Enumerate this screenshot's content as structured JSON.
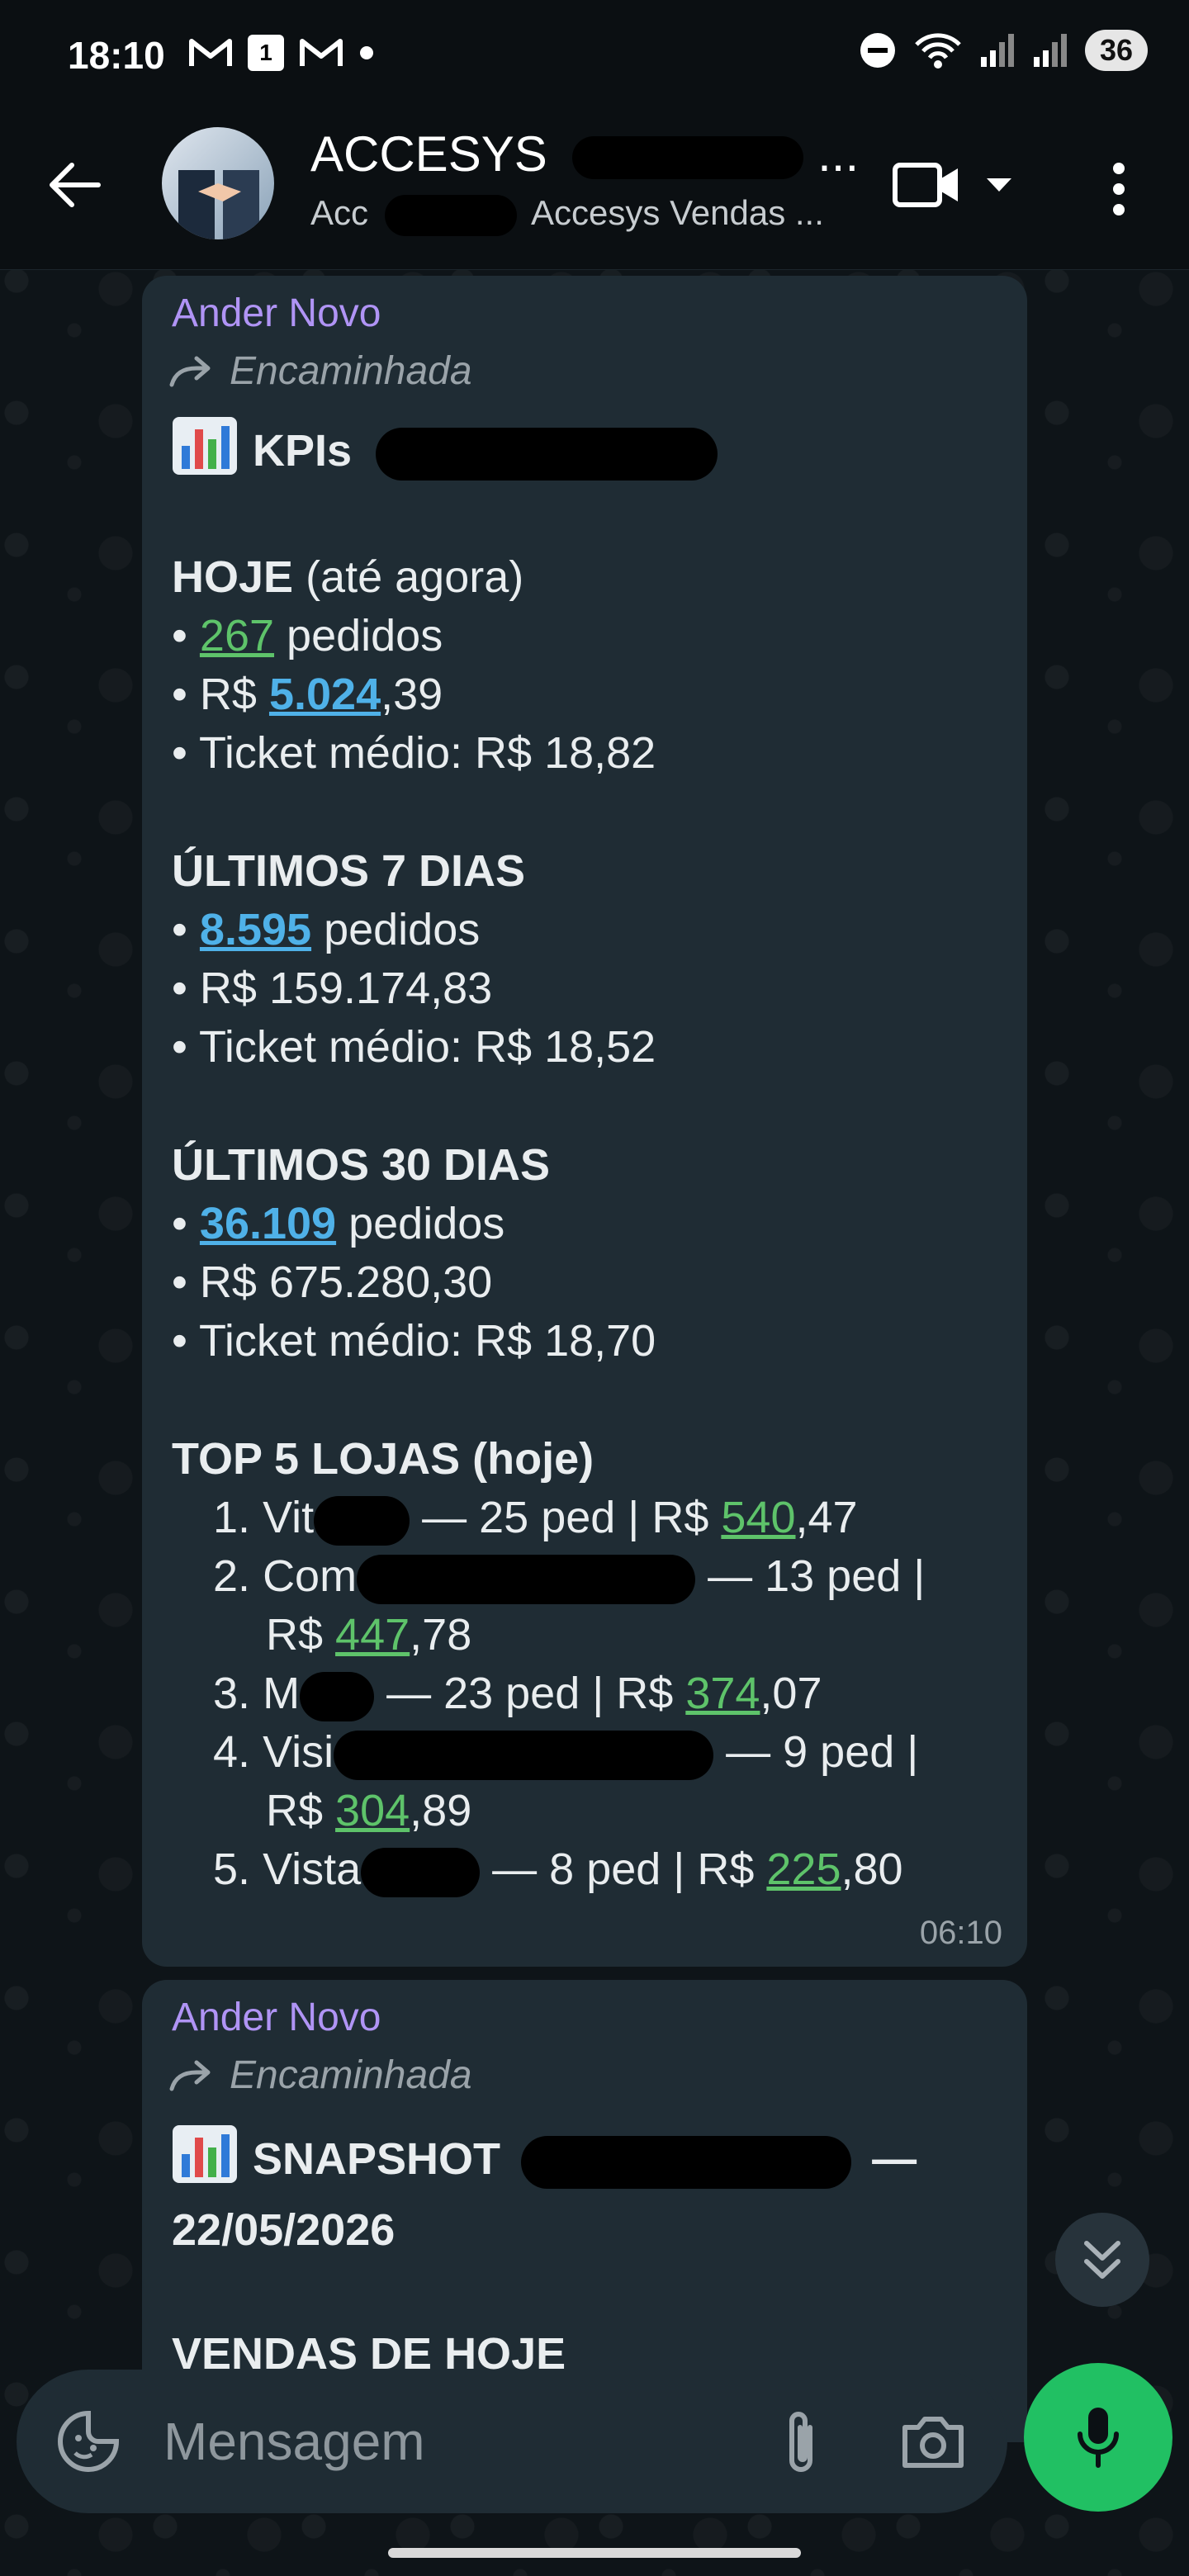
{
  "status": {
    "time": "18:10",
    "notif_icons": [
      "gmail-icon",
      "calendar-icon",
      "gmail-icon",
      "dot-icon"
    ],
    "calendar_day": "1",
    "battery": "36"
  },
  "header": {
    "title_prefix": "ACCESYS",
    "title_suffix": "...",
    "subtitle_prefix": "Acc",
    "subtitle_suffix": "Accesys Vendas ..."
  },
  "messages": [
    {
      "sender": "Ander Novo",
      "forwarded_label": "Encaminhada",
      "title": "KPIs",
      "hoje_title": "HOJE",
      "hoje_note": "(até agora)",
      "hoje_orders_num": "267",
      "hoje_orders_label": "pedidos",
      "hoje_rev_prefix": "R$",
      "hoje_rev_link": "5.024",
      "hoje_rev_suffix": ",39",
      "hoje_ticket": "Ticket médio: R$ 18,82",
      "d7_title": "ÚLTIMOS 7 DIAS",
      "d7_orders_num": "8.595",
      "d7_orders_label": "pedidos",
      "d7_rev": "R$ 159.174,83",
      "d7_ticket": "Ticket médio: R$ 18,52",
      "d30_title": "ÚLTIMOS 30 DIAS",
      "d30_orders_num": "36.109",
      "d30_orders_label": "pedidos",
      "d30_rev": "R$ 675.280,30",
      "d30_ticket": "Ticket médio: R$ 18,70",
      "top_title": "TOP 5 LOJAS (hoje)",
      "stores": [
        {
          "n": "1.",
          "name": "Vit",
          "ped": "— 25 ped | R$",
          "v1": "540",
          "v2": ",47"
        },
        {
          "n": "2.",
          "name": "Com",
          "ped": "— 13 ped |",
          "ped2": "R$",
          "v1": "447",
          "v2": ",78"
        },
        {
          "n": "3.",
          "name": "M",
          "ped": "— 23 ped | R$",
          "v1": "374",
          "v2": ",07"
        },
        {
          "n": "4.",
          "name": "Visi",
          "ped": "— 9 ped |",
          "ped2": "R$",
          "v1": "304",
          "v2": ",89"
        },
        {
          "n": "5.",
          "name": "Vista",
          "ped": "— 8 ped | R$",
          "v1": "225",
          "v2": ",80"
        }
      ],
      "time": "06:10"
    },
    {
      "sender": "Ander Novo",
      "forwarded_label": "Encaminhada",
      "title": "SNAPSHOT",
      "title_dash": "—",
      "date": "22/05/2026",
      "section": "VENDAS DE HOJE"
    }
  ],
  "composer": {
    "placeholder": "Mensagem"
  }
}
